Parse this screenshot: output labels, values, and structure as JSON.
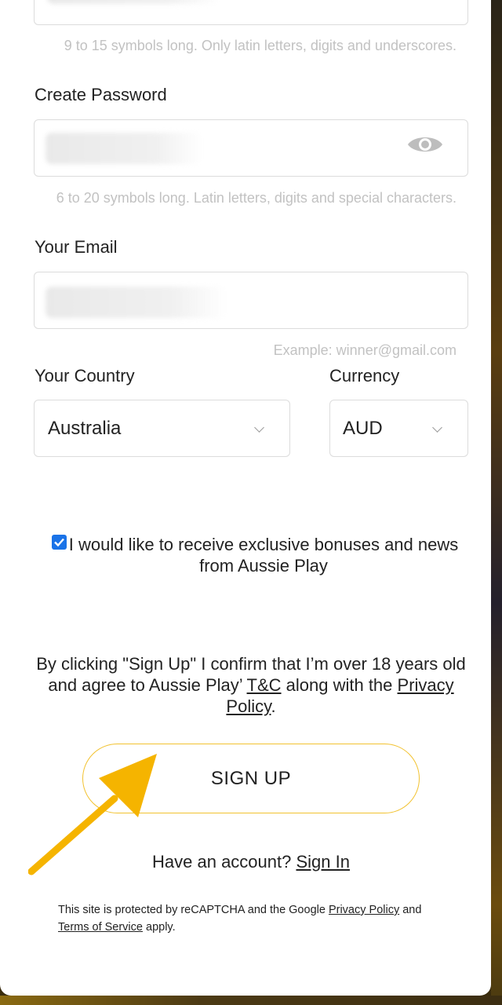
{
  "username": {
    "hint": "9 to 15 symbols long. Only latin letters, digits and underscores."
  },
  "password": {
    "label": "Create Password",
    "hint": "6 to 20 symbols long. Latin letters, digits and special characters.",
    "toggle_icon": "eye-icon"
  },
  "email": {
    "label": "Your Email",
    "hint": "Example: winner@gmail.com"
  },
  "country": {
    "label": "Your Country",
    "value": "Australia"
  },
  "currency": {
    "label": "Currency",
    "value": "AUD"
  },
  "consent": {
    "checked": true,
    "text": "I would like to receive exclusive bonuses and news from Aussie Play"
  },
  "terms": {
    "prefix": "By clicking \"Sign Up\" I confirm that I’m over 18 years old and agree to Aussie Play’ ",
    "tc_link": "T&C",
    "middle": " along with the ",
    "privacy_link": "Privacy Policy",
    "suffix": "."
  },
  "signup_button": "SIGN UP",
  "account": {
    "question": "Have an account? ",
    "sign_in_link": "Sign In"
  },
  "recaptcha": {
    "prefix": "This site is protected by reCAPTCHA and the Google ",
    "privacy_link": "Privacy Policy",
    "middle": " and ",
    "terms_link": "Terms of Service",
    "suffix": " apply."
  },
  "colors": {
    "accent_border": "#f2c230",
    "arrow": "#f5b400",
    "checkbox": "#1a73e8"
  }
}
